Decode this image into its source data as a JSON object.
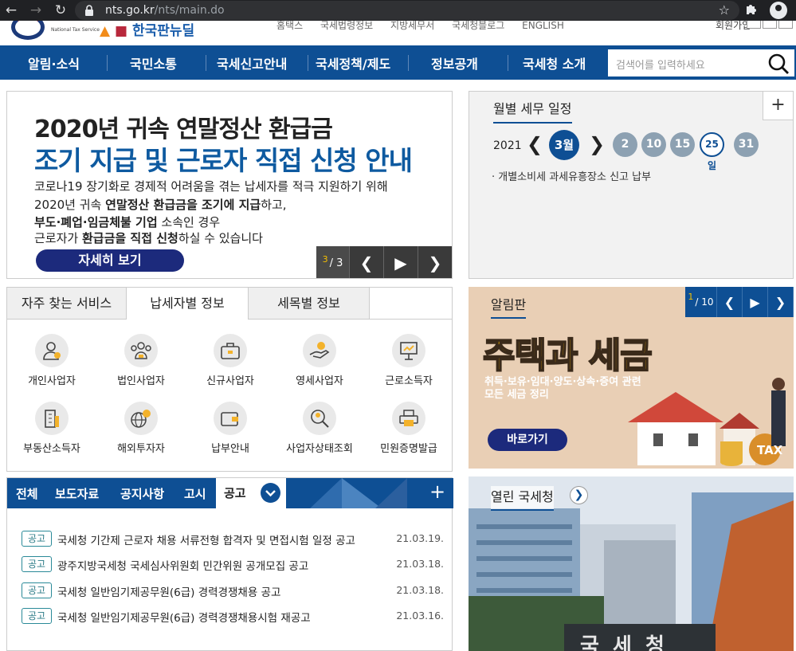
{
  "browser": {
    "url_host": "nts.go.kr",
    "url_path": "/nts/main.do"
  },
  "topbar": {
    "logo_sub": "National Tax Service",
    "campaign_text": "한국판뉴딜",
    "util_items": [
      "홈택스",
      "국세법령정보",
      "지방세무서",
      "국세청블로그",
      "ENGLISH"
    ],
    "login": "회원가입"
  },
  "nav": {
    "items": [
      "알림·소식",
      "국민소통",
      "국세신고안내",
      "국세정책/제도",
      "정보공개",
      "국세청 소개"
    ],
    "search_placeholder": "검색어를 입력하세요"
  },
  "banner": {
    "title1": "2020년 귀속 연말정산 환급금",
    "title2": "조기 지급 및 근로자 직접 신청 안내",
    "line1": "코로나19 장기화로 경제적 어려움을 겪는 납세자를 적극 지원하기 위해",
    "line2_pre": "2020년 귀속 ",
    "line2_bold": "연말정산 환급금을 조기에 지급",
    "line2_post": "하고,",
    "line3_bold": "부도·폐업·임금체불 기업",
    "line3_post": " 소속인 경우",
    "line4_pre": "근로자가 ",
    "line4_bold": "환급금을 직접 신청",
    "line4_post": "하실 수 있습니다",
    "button": "자세히 보기",
    "page_current": "3",
    "page_total": "/ 3"
  },
  "schedule": {
    "title": "월별 세무 일정",
    "year": "2021",
    "month": "3월",
    "days": [
      "2",
      "10",
      "15",
      "25일",
      "31"
    ],
    "item": "· 개별소비세 과세유흥장소 신고 납부"
  },
  "services": {
    "tabs": [
      "자주 찾는 서비스",
      "납세자별 정보",
      "세목별 정보"
    ],
    "active_tab": 1,
    "items": [
      {
        "label": "개인사업자",
        "icon": "person-icon"
      },
      {
        "label": "법인사업자",
        "icon": "group-icon"
      },
      {
        "label": "신규사업자",
        "icon": "briefcase-icon"
      },
      {
        "label": "영세사업자",
        "icon": "hand-coins-icon"
      },
      {
        "label": "근로소득자",
        "icon": "presentation-icon"
      },
      {
        "label": "부동산소득자",
        "icon": "building-icon"
      },
      {
        "label": "해외투자자",
        "icon": "globe-dollar-icon"
      },
      {
        "label": "납부안내",
        "icon": "wallet-icon"
      },
      {
        "label": "사업자상태조회",
        "icon": "magnifier-person-icon"
      },
      {
        "label": "민원증명발급",
        "icon": "printer-icon"
      }
    ]
  },
  "notices": {
    "tabs": [
      "전체",
      "보도자료",
      "공지사항",
      "고시",
      "공고"
    ],
    "active_tab": "공고",
    "items": [
      {
        "badge": "공고",
        "text": "국세청 기간제 근로자 채용 서류전형 합격자 및 면접시험 일정 공고",
        "date": "21.03.19."
      },
      {
        "badge": "공고",
        "text": "광주지방국세청 국세심사위원회 민간위원 공개모집 공고",
        "date": "21.03.18."
      },
      {
        "badge": "공고",
        "text": "국세청 일반임기제공무원(6급) 경력경쟁채용 공고",
        "date": "21.03.18."
      },
      {
        "badge": "공고",
        "text": "국세청 일반임기제공무원(6급) 경력경쟁채용시험 재공고",
        "date": "21.03.16."
      }
    ]
  },
  "board": {
    "title": "알림판",
    "page_current": "1",
    "page_total": "/ 10",
    "headline": "주택과 세금",
    "sub1": "취득·보유·임대·양도·상속·증여 관련",
    "sub2": "모든 세금 정리",
    "button": "바로가기",
    "coin_text": "TAX"
  },
  "open_nts": {
    "title": "열린 국세청",
    "sign": "국 세 청"
  }
}
